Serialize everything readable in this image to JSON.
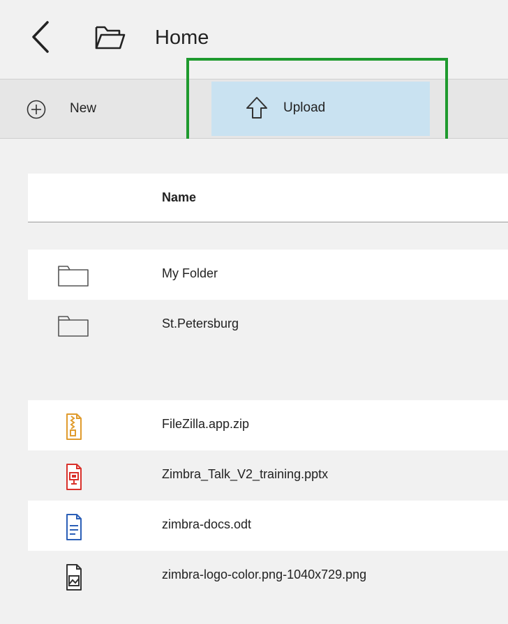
{
  "header": {
    "title": "Home",
    "back_icon": "chevron-left-icon",
    "folder_icon": "folder-open-icon"
  },
  "toolbar": {
    "new_label": "New",
    "new_icon": "plus-circle-icon",
    "upload_label": "Upload",
    "upload_icon": "arrow-up-icon",
    "upload_highlight_color": "#c9e2f1",
    "annotation_color": "#1e9a2e"
  },
  "list": {
    "column_name": "Name",
    "folders": [
      {
        "label": "My Folder",
        "icon": "folder-icon"
      },
      {
        "label": "St.Petersburg",
        "icon": "folder-icon"
      }
    ],
    "files": [
      {
        "label": "FileZilla.app.zip",
        "icon": "zip-file-icon",
        "color": "#e09b2d"
      },
      {
        "label": "Zimbra_Talk_V2_training.pptx",
        "icon": "presentation-file-icon",
        "color": "#d9312b"
      },
      {
        "label": "zimbra-docs.odt",
        "icon": "document-file-icon",
        "color": "#2b5fb7"
      },
      {
        "label": "zimbra-logo-color.png-1040x729.png",
        "icon": "image-file-icon",
        "color": "#333333"
      }
    ]
  }
}
